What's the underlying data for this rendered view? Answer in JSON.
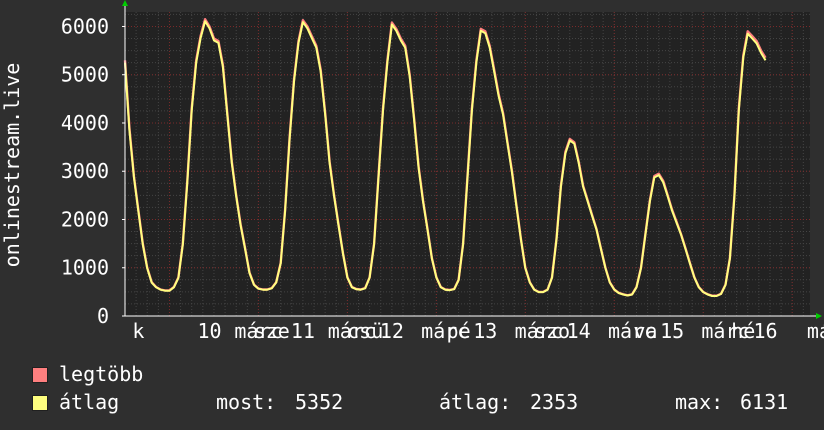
{
  "chart_data": {
    "type": "line",
    "ylabel": "onlinestream.live",
    "ylim": [
      0,
      6300
    ],
    "yticks": [
      0,
      1000,
      2000,
      3000,
      4000,
      5000,
      6000
    ],
    "ytick_labels": [
      "0",
      "1000",
      "2000",
      "3000",
      "4000",
      "5000",
      "6000"
    ],
    "xticks": [
      {
        "label": "k",
        "x": 0.15
      },
      {
        "label": "10",
        "x": 0.95
      },
      {
        "label": "márc",
        "x": 1.5
      },
      {
        "label": "sze",
        "x": 1.65
      },
      {
        "label": "11",
        "x": 2.0
      },
      {
        "label": "márc",
        "x": 2.55
      },
      {
        "label": "csü",
        "x": 2.7
      },
      {
        "label": "12",
        "x": 3.0
      },
      {
        "label": "márc",
        "x": 3.6
      },
      {
        "label": "pé",
        "x": 3.75
      },
      {
        "label": "13",
        "x": 4.05
      },
      {
        "label": "márc",
        "x": 4.65
      },
      {
        "label": "szo",
        "x": 4.8
      },
      {
        "label": "14",
        "x": 5.1
      },
      {
        "label": "márc",
        "x": 5.7
      },
      {
        "label": "va",
        "x": 5.85
      },
      {
        "label": "15",
        "x": 6.15
      },
      {
        "label": "márc",
        "x": 6.75
      },
      {
        "label": "hé",
        "x": 6.95
      },
      {
        "label": "16",
        "x": 7.2
      },
      {
        "label": "má",
        "x": 7.8
      }
    ],
    "grid": true,
    "legend_position": "bottom-left",
    "x": [
      0.0,
      0.05,
      0.1,
      0.15,
      0.2,
      0.25,
      0.3,
      0.35,
      0.4,
      0.45,
      0.5,
      0.55,
      0.6,
      0.65,
      0.7,
      0.75,
      0.8,
      0.85,
      0.9,
      0.95,
      1.0,
      1.05,
      1.1,
      1.15,
      1.2,
      1.25,
      1.3,
      1.35,
      1.4,
      1.45,
      1.5,
      1.55,
      1.6,
      1.65,
      1.7,
      1.75,
      1.8,
      1.85,
      1.9,
      1.95,
      2.0,
      2.05,
      2.1,
      2.15,
      2.2,
      2.25,
      2.3,
      2.35,
      2.4,
      2.45,
      2.5,
      2.55,
      2.6,
      2.65,
      2.7,
      2.75,
      2.8,
      2.85,
      2.9,
      2.95,
      3.0,
      3.05,
      3.1,
      3.15,
      3.2,
      3.25,
      3.3,
      3.35,
      3.4,
      3.45,
      3.5,
      3.55,
      3.6,
      3.65,
      3.7,
      3.75,
      3.8,
      3.85,
      3.9,
      3.95,
      4.0,
      4.05,
      4.1,
      4.15,
      4.2,
      4.25,
      4.3,
      4.35,
      4.4,
      4.45,
      4.5,
      4.55,
      4.6,
      4.65,
      4.7,
      4.75,
      4.8,
      4.85,
      4.9,
      4.95,
      5.0,
      5.05,
      5.1,
      5.15,
      5.2,
      5.25,
      5.3,
      5.35,
      5.4,
      5.45,
      5.5,
      5.55,
      5.6,
      5.65,
      5.7,
      5.75,
      5.8,
      5.85,
      5.9,
      5.95,
      6.0,
      6.05,
      6.1,
      6.15,
      6.2,
      6.25,
      6.3,
      6.35,
      6.4,
      6.45,
      6.5,
      6.55,
      6.6,
      6.65,
      6.7,
      6.75,
      6.8,
      6.85,
      6.9,
      6.95,
      7.0,
      7.05,
      7.1,
      7.15,
      7.2,
      7.25,
      7.3,
      7.35,
      7.4,
      7.45,
      7.5,
      7.55,
      7.6,
      7.65,
      7.7
    ],
    "series": [
      {
        "name": "legtöbb",
        "color": "#ff7f7f",
        "values": [
          5300,
          3900,
          2900,
          2200,
          1500,
          1000,
          700,
          600,
          550,
          530,
          530,
          600,
          800,
          1500,
          2800,
          4300,
          5300,
          5800,
          6150,
          6000,
          5750,
          5700,
          5200,
          4200,
          3200,
          2500,
          1900,
          1400,
          900,
          650,
          570,
          550,
          550,
          580,
          700,
          1100,
          2200,
          3700,
          4900,
          5700,
          6130,
          6000,
          5800,
          5600,
          5100,
          4200,
          3200,
          2500,
          1900,
          1300,
          800,
          600,
          560,
          550,
          580,
          800,
          1500,
          2900,
          4300,
          5300,
          6080,
          5950,
          5750,
          5600,
          5000,
          4100,
          3100,
          2400,
          1800,
          1200,
          800,
          600,
          550,
          540,
          560,
          750,
          1500,
          2900,
          4300,
          5300,
          5950,
          5900,
          5600,
          5100,
          4600,
          4200,
          3600,
          3000,
          2300,
          1600,
          1000,
          700,
          550,
          500,
          500,
          550,
          800,
          1600,
          2700,
          3400,
          3670,
          3600,
          3200,
          2700,
          2400,
          2100,
          1800,
          1400,
          1000,
          700,
          550,
          480,
          450,
          430,
          450,
          600,
          1000,
          1700,
          2400,
          2900,
          2950,
          2800,
          2500,
          2200,
          1950,
          1700,
          1400,
          1100,
          800,
          600,
          500,
          450,
          420,
          420,
          460,
          650,
          1200,
          2500,
          4300,
          5400,
          5900,
          5800,
          5700,
          5500,
          5352
        ]
      },
      {
        "name": "átlag",
        "color": "#ffff7f",
        "values": [
          5250,
          3850,
          2880,
          2180,
          1480,
          990,
          690,
          595,
          545,
          525,
          525,
          595,
          790,
          1480,
          2770,
          4260,
          5250,
          5760,
          6110,
          5960,
          5710,
          5660,
          5160,
          4170,
          3170,
          2480,
          1880,
          1390,
          890,
          645,
          565,
          545,
          545,
          575,
          695,
          1090,
          2180,
          3670,
          4860,
          5660,
          6090,
          5960,
          5760,
          5560,
          5060,
          4170,
          3170,
          2480,
          1880,
          1290,
          795,
          595,
          555,
          545,
          575,
          795,
          1490,
          2870,
          4260,
          5260,
          6040,
          5910,
          5710,
          5560,
          4960,
          4070,
          3070,
          2380,
          1790,
          1190,
          795,
          595,
          545,
          535,
          555,
          745,
          1490,
          2870,
          4260,
          5260,
          5910,
          5860,
          5560,
          5060,
          4560,
          4170,
          3570,
          2970,
          2280,
          1590,
          995,
          695,
          545,
          495,
          495,
          545,
          795,
          1590,
          2680,
          3370,
          3640,
          3570,
          3170,
          2680,
          2380,
          2080,
          1790,
          1390,
          995,
          695,
          545,
          475,
          445,
          425,
          445,
          595,
          995,
          1690,
          2380,
          2870,
          2920,
          2770,
          2480,
          2180,
          1930,
          1690,
          1390,
          1090,
          795,
          595,
          495,
          445,
          415,
          415,
          455,
          645,
          1190,
          2480,
          4260,
          5360,
          5850,
          5750,
          5650,
          5450,
          5300
        ]
      }
    ]
  },
  "legend": {
    "max_label": "legtöbb",
    "avg_label": "átlag",
    "max_color": "#ff7f7f",
    "avg_color": "#ffff7f",
    "stats": {
      "most_label": "most:",
      "most_value": "5352",
      "avg_label": "átlag:",
      "avg_value": "2353",
      "max_label": "max:",
      "max_value": "6131"
    }
  },
  "colors": {
    "background": "#2f2f2f",
    "plot_background": "#222222",
    "grid_major": "#7a2a2a",
    "grid_minor": "#444444",
    "axis": "#ffffff",
    "arrow": "#00cc00"
  }
}
